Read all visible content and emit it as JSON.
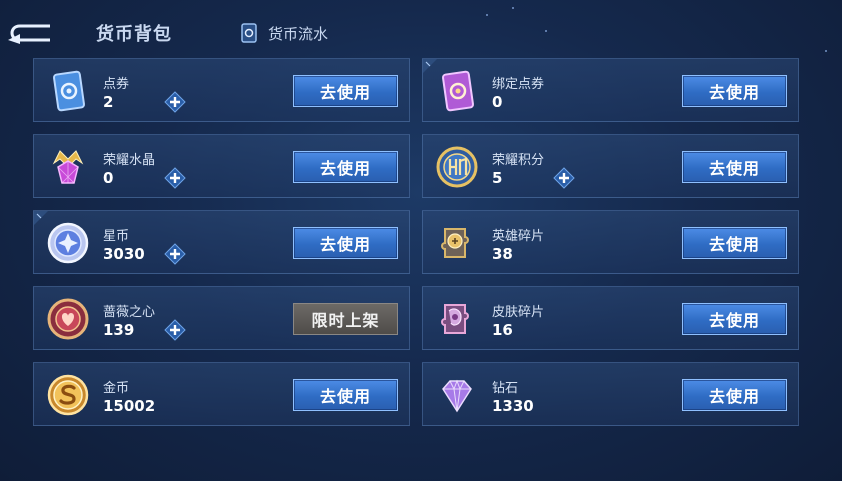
{
  "header": {
    "active_tab": "货币背包",
    "flow_tab": "货币流水",
    "back_icon": "back-arrow-icon",
    "flow_icon": "card-icon"
  },
  "cards": [
    {
      "name": "点券",
      "amount": "2",
      "button": "去使用",
      "icon": "voucher-card-icon",
      "has_plus": true
    },
    {
      "name": "绑定点券",
      "amount": "0",
      "button": "去使用",
      "icon": "bound-voucher-card-icon",
      "has_plus": false
    },
    {
      "name": "荣耀水晶",
      "amount": "0",
      "button": "去使用",
      "icon": "glory-crystal-icon",
      "has_plus": true
    },
    {
      "name": "荣耀积分",
      "amount": "5",
      "button": "去使用",
      "icon": "glory-points-icon",
      "has_plus": true
    },
    {
      "name": "星币",
      "amount": "3030",
      "button": "去使用",
      "icon": "star-coin-icon",
      "has_plus": true
    },
    {
      "name": "英雄碎片",
      "amount": "38",
      "button": "去使用",
      "icon": "hero-fragment-icon",
      "has_plus": false
    },
    {
      "name": "蔷薇之心",
      "amount": "139",
      "button": "限时上架",
      "icon": "rose-heart-icon",
      "has_plus": true
    },
    {
      "name": "皮肤碎片",
      "amount": "16",
      "button": "去使用",
      "icon": "skin-fragment-icon",
      "has_plus": false
    },
    {
      "name": "金币",
      "amount": "15002",
      "button": "去使用",
      "icon": "gold-coin-icon",
      "has_plus": false
    },
    {
      "name": "钻石",
      "amount": "1330",
      "button": "去使用",
      "icon": "diamond-icon",
      "has_plus": false
    }
  ],
  "colors": {
    "accent_button": "#3a78d2",
    "limited_button": "#5e5b58",
    "background": "#15294d"
  }
}
